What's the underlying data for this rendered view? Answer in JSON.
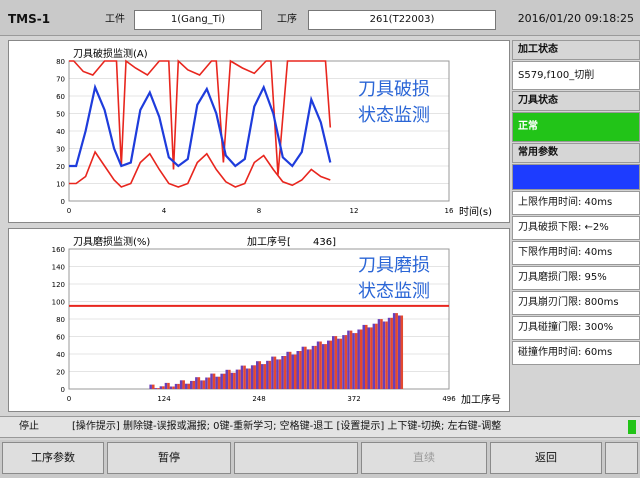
{
  "header": {
    "app": "TMS-1",
    "workpiece_label": "工件",
    "workpiece_value": "1(Gang_Ti)",
    "process_label": "工序",
    "process_value": "261(T22003)",
    "datetime": "2016/01/20 09:18:25"
  },
  "sidebar": {
    "rows": [
      {
        "text": "加工状态",
        "kind": "hdr"
      },
      {
        "text": "S579,f100_切削",
        "kind": "val"
      },
      {
        "text": "刀具状态",
        "kind": "hdr"
      },
      {
        "text": "正常",
        "kind": "ok"
      },
      {
        "text": "常用参数",
        "kind": "hdr"
      },
      {
        "text": "",
        "kind": "sel"
      },
      {
        "text": "上限作用时间: 40ms",
        "kind": "val"
      },
      {
        "text": "刀具破损下限: ←2%",
        "kind": "val"
      },
      {
        "text": "下限作用时间: 40ms",
        "kind": "val"
      },
      {
        "text": "刀具磨损门限: 95%",
        "kind": "val"
      },
      {
        "text": "刀具崩刃门限: 800ms",
        "kind": "val"
      },
      {
        "text": "刀具碰撞门限: 300%",
        "kind": "val"
      },
      {
        "text": "碰撞作用时间: 60ms",
        "kind": "val"
      }
    ]
  },
  "status": {
    "state": "停止",
    "hint": "[操作提示] 删除键-误报或漏报; 0键-重新学习; 空格键-退工 [设置提示] 上下键-切换; 左右键-调整"
  },
  "buttons": [
    {
      "label": "工序参数",
      "disabled": false
    },
    {
      "label": "暂停",
      "disabled": false
    },
    {
      "label": "",
      "disabled": false
    },
    {
      "label": "直续",
      "disabled": true
    },
    {
      "label": "返回",
      "disabled": false
    },
    {
      "label": "",
      "disabled": false
    }
  ],
  "chart_data": [
    {
      "type": "line",
      "title": "刀具破损监测(A)",
      "annotation": [
        "刀具破损",
        "状态监测"
      ],
      "xlabel": "时间(s)",
      "xlim": [
        0,
        16
      ],
      "ylim": [
        0,
        80
      ],
      "xticks": [
        "0",
        "4",
        "8",
        "12",
        "16"
      ],
      "yticks": [
        "0",
        "10",
        "20",
        "30",
        "40",
        "50",
        "60",
        "70",
        "80"
      ],
      "series": [
        {
          "color": "#e8261e",
          "x": [
            0,
            0.2,
            0.6,
            1.0,
            1.5,
            2.0,
            2.2,
            2.4,
            2.8,
            3.3,
            3.8,
            4.2,
            4.4,
            4.6,
            5.0,
            5.5,
            6.0,
            6.2,
            6.5,
            6.8,
            7.3,
            7.8,
            8.3,
            8.5,
            8.8,
            9.2,
            9.8,
            10.3,
            10.8,
            11.0
          ],
          "y": [
            80,
            80,
            74,
            72,
            80,
            80,
            20,
            80,
            76,
            72,
            80,
            80,
            18,
            80,
            75,
            72,
            80,
            80,
            22,
            80,
            76,
            73,
            80,
            80,
            15,
            80,
            80,
            80,
            80,
            42
          ]
        },
        {
          "color": "#1e3cdc",
          "x": [
            0,
            0.3,
            0.7,
            1.1,
            1.5,
            1.9,
            2.2,
            2.6,
            3.0,
            3.4,
            3.8,
            4.2,
            4.6,
            5.0,
            5.4,
            5.8,
            6.2,
            6.6,
            7.0,
            7.4,
            7.8,
            8.2,
            8.6,
            9.0,
            9.4,
            9.8,
            10.2,
            10.6,
            11.0
          ],
          "y": [
            20,
            20,
            40,
            65,
            52,
            30,
            20,
            22,
            52,
            62,
            48,
            25,
            20,
            24,
            55,
            64,
            50,
            26,
            20,
            24,
            54,
            65,
            50,
            25,
            20,
            28,
            58,
            45,
            22
          ]
        },
        {
          "color": "#e8261e",
          "x": [
            0,
            0.3,
            0.7,
            1.1,
            1.5,
            1.9,
            2.2,
            2.6,
            3.0,
            3.4,
            3.8,
            4.2,
            4.6,
            5.0,
            5.4,
            5.8,
            6.2,
            6.6,
            7.0,
            7.4,
            7.8,
            8.2,
            8.6,
            9.0,
            9.4,
            9.8,
            10.2,
            10.6,
            11.0
          ],
          "y": [
            10,
            10,
            14,
            28,
            20,
            12,
            8,
            10,
            22,
            27,
            18,
            10,
            8,
            10,
            22,
            27,
            18,
            11,
            8,
            10,
            22,
            26,
            18,
            11,
            9,
            12,
            18,
            14,
            12
          ]
        }
      ]
    },
    {
      "type": "bar",
      "title": "刀具磨损监测(%)",
      "counter_label": "加工序号[",
      "counter_value": "436]",
      "annotation": [
        "刀具磨损",
        "状态监测"
      ],
      "xlabel": "加工序号",
      "xlim": [
        0,
        496
      ],
      "ylim": [
        0,
        160
      ],
      "xticks": [
        "0",
        "124",
        "248",
        "372",
        "496"
      ],
      "yticks": [
        "0",
        "20",
        "40",
        "60",
        "80",
        "100",
        "120",
        "140",
        "160"
      ],
      "threshold": 95,
      "bar_count": 50,
      "bar_start": 105,
      "bar_end": 436,
      "value_start": 2,
      "value_end": 86
    }
  ]
}
